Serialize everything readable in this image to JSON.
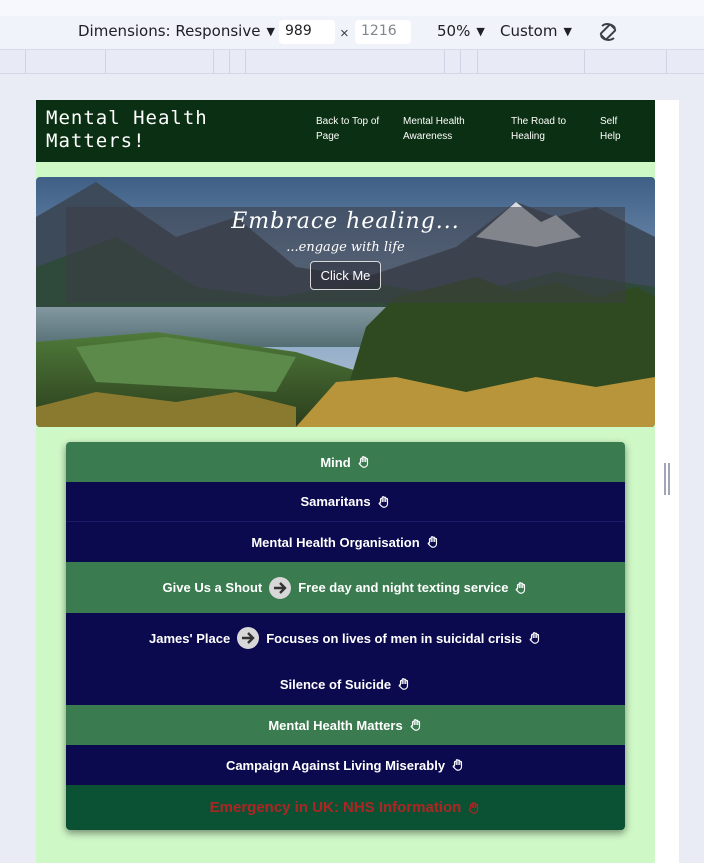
{
  "devtools": {
    "dimensions_label": "Dimensions: Responsive",
    "width_value": "989",
    "height_value": "1216",
    "times": "×",
    "zoom_label": "50%",
    "throttle_label": "Custom"
  },
  "nav": {
    "brand_line1": "Mental Health",
    "brand_line2": "Matters!",
    "links": [
      {
        "line1": "Back to Top of",
        "line2": "Page"
      },
      {
        "line1": "Mental Health",
        "line2": "Awareness"
      },
      {
        "line1": "The Road to",
        "line2": "Healing"
      },
      {
        "line1": "Self",
        "line2": "Help"
      }
    ]
  },
  "hero": {
    "title": "Embrace healing...",
    "subtitle": "...engage with life",
    "button": "Click Me"
  },
  "links": [
    {
      "label": "Mind",
      "detail": ""
    },
    {
      "label": "Samaritans",
      "detail": ""
    },
    {
      "label": "Mental Health Organisation",
      "detail": ""
    },
    {
      "label": "Give Us a Shout",
      "detail": "Free day and night texting service"
    },
    {
      "label": "James' Place",
      "detail": "Focuses on lives of men in suicidal crisis"
    },
    {
      "label": "Silence of Suicide",
      "detail": ""
    },
    {
      "label": "Mental Health Matters",
      "detail": ""
    },
    {
      "label": "Campaign Against Living Miserably",
      "detail": ""
    },
    {
      "label": "Emergency in UK: NHS Information",
      "detail": ""
    }
  ],
  "colors": {
    "nav_bg": "#0a2f12",
    "page_bg": "#cff8c7",
    "row_green": "#3b7b50",
    "row_navy": "#0c0a4f",
    "emergency_text": "#b02424"
  }
}
